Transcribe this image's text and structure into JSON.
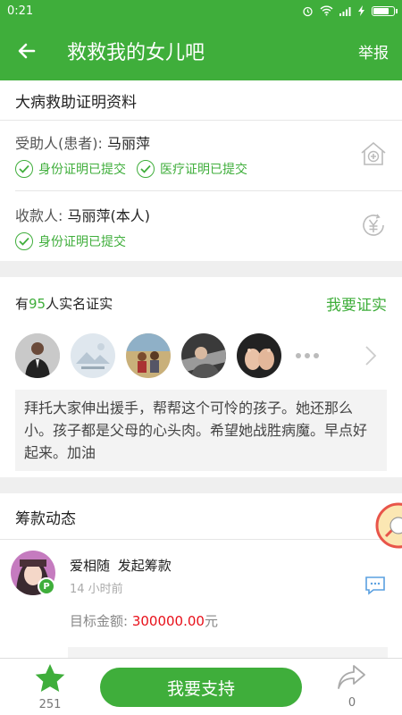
{
  "status_bar": {
    "time": "0:21"
  },
  "app_bar": {
    "title": "救救我的女儿吧",
    "report_label": "举报"
  },
  "proof": {
    "title": "大病救助证明资料",
    "patient_label": "受助人(患者): ",
    "patient_name": "马丽萍",
    "patient_checks": [
      "身份证明已提交",
      "医疗证明已提交"
    ],
    "payee_label": "收款人: ",
    "payee_name": "马丽萍(本人)",
    "payee_checks": [
      "身份证明已提交"
    ]
  },
  "verify": {
    "prefix": "有",
    "count": "95",
    "suffix": "人实名证实",
    "link_label": "我要证实",
    "message": "拜托大家伸出援手，帮帮这个可怜的孩子。她还那么小。孩子都是父母的心头肉。希望她战胜病魔。早点好起来。加油"
  },
  "funding": {
    "title": "筹款动态",
    "user": "爱相随",
    "action": "发起筹款",
    "time": "14 小时前",
    "target_label": "目标金额: ",
    "target_amount": "300000.00",
    "target_unit": "元"
  },
  "bottom": {
    "star_count": "251",
    "support_label": "我要支持",
    "share_count": "0"
  },
  "colors": {
    "brand": "#3fae3b",
    "amount": "#e8101a"
  }
}
